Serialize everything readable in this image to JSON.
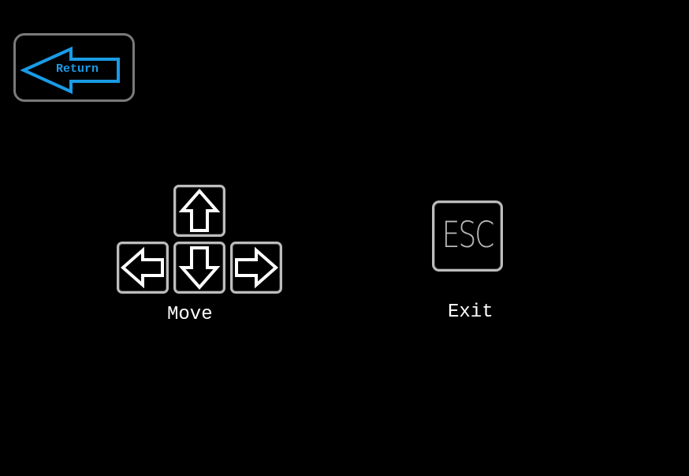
{
  "return_button": {
    "label": "Return",
    "icon": "left-arrow-icon",
    "accent_color": "#1a9be6",
    "border_color": "#7a7a7a"
  },
  "controls": {
    "move": {
      "label": "Move",
      "keys": [
        "up-arrow-key",
        "left-arrow-key",
        "down-arrow-key",
        "right-arrow-key"
      ]
    },
    "exit": {
      "label": "Exit",
      "key_label": "ESC"
    }
  },
  "colors": {
    "background": "#000000",
    "text": "#ffffff",
    "key_border": "#bdbdbd"
  }
}
